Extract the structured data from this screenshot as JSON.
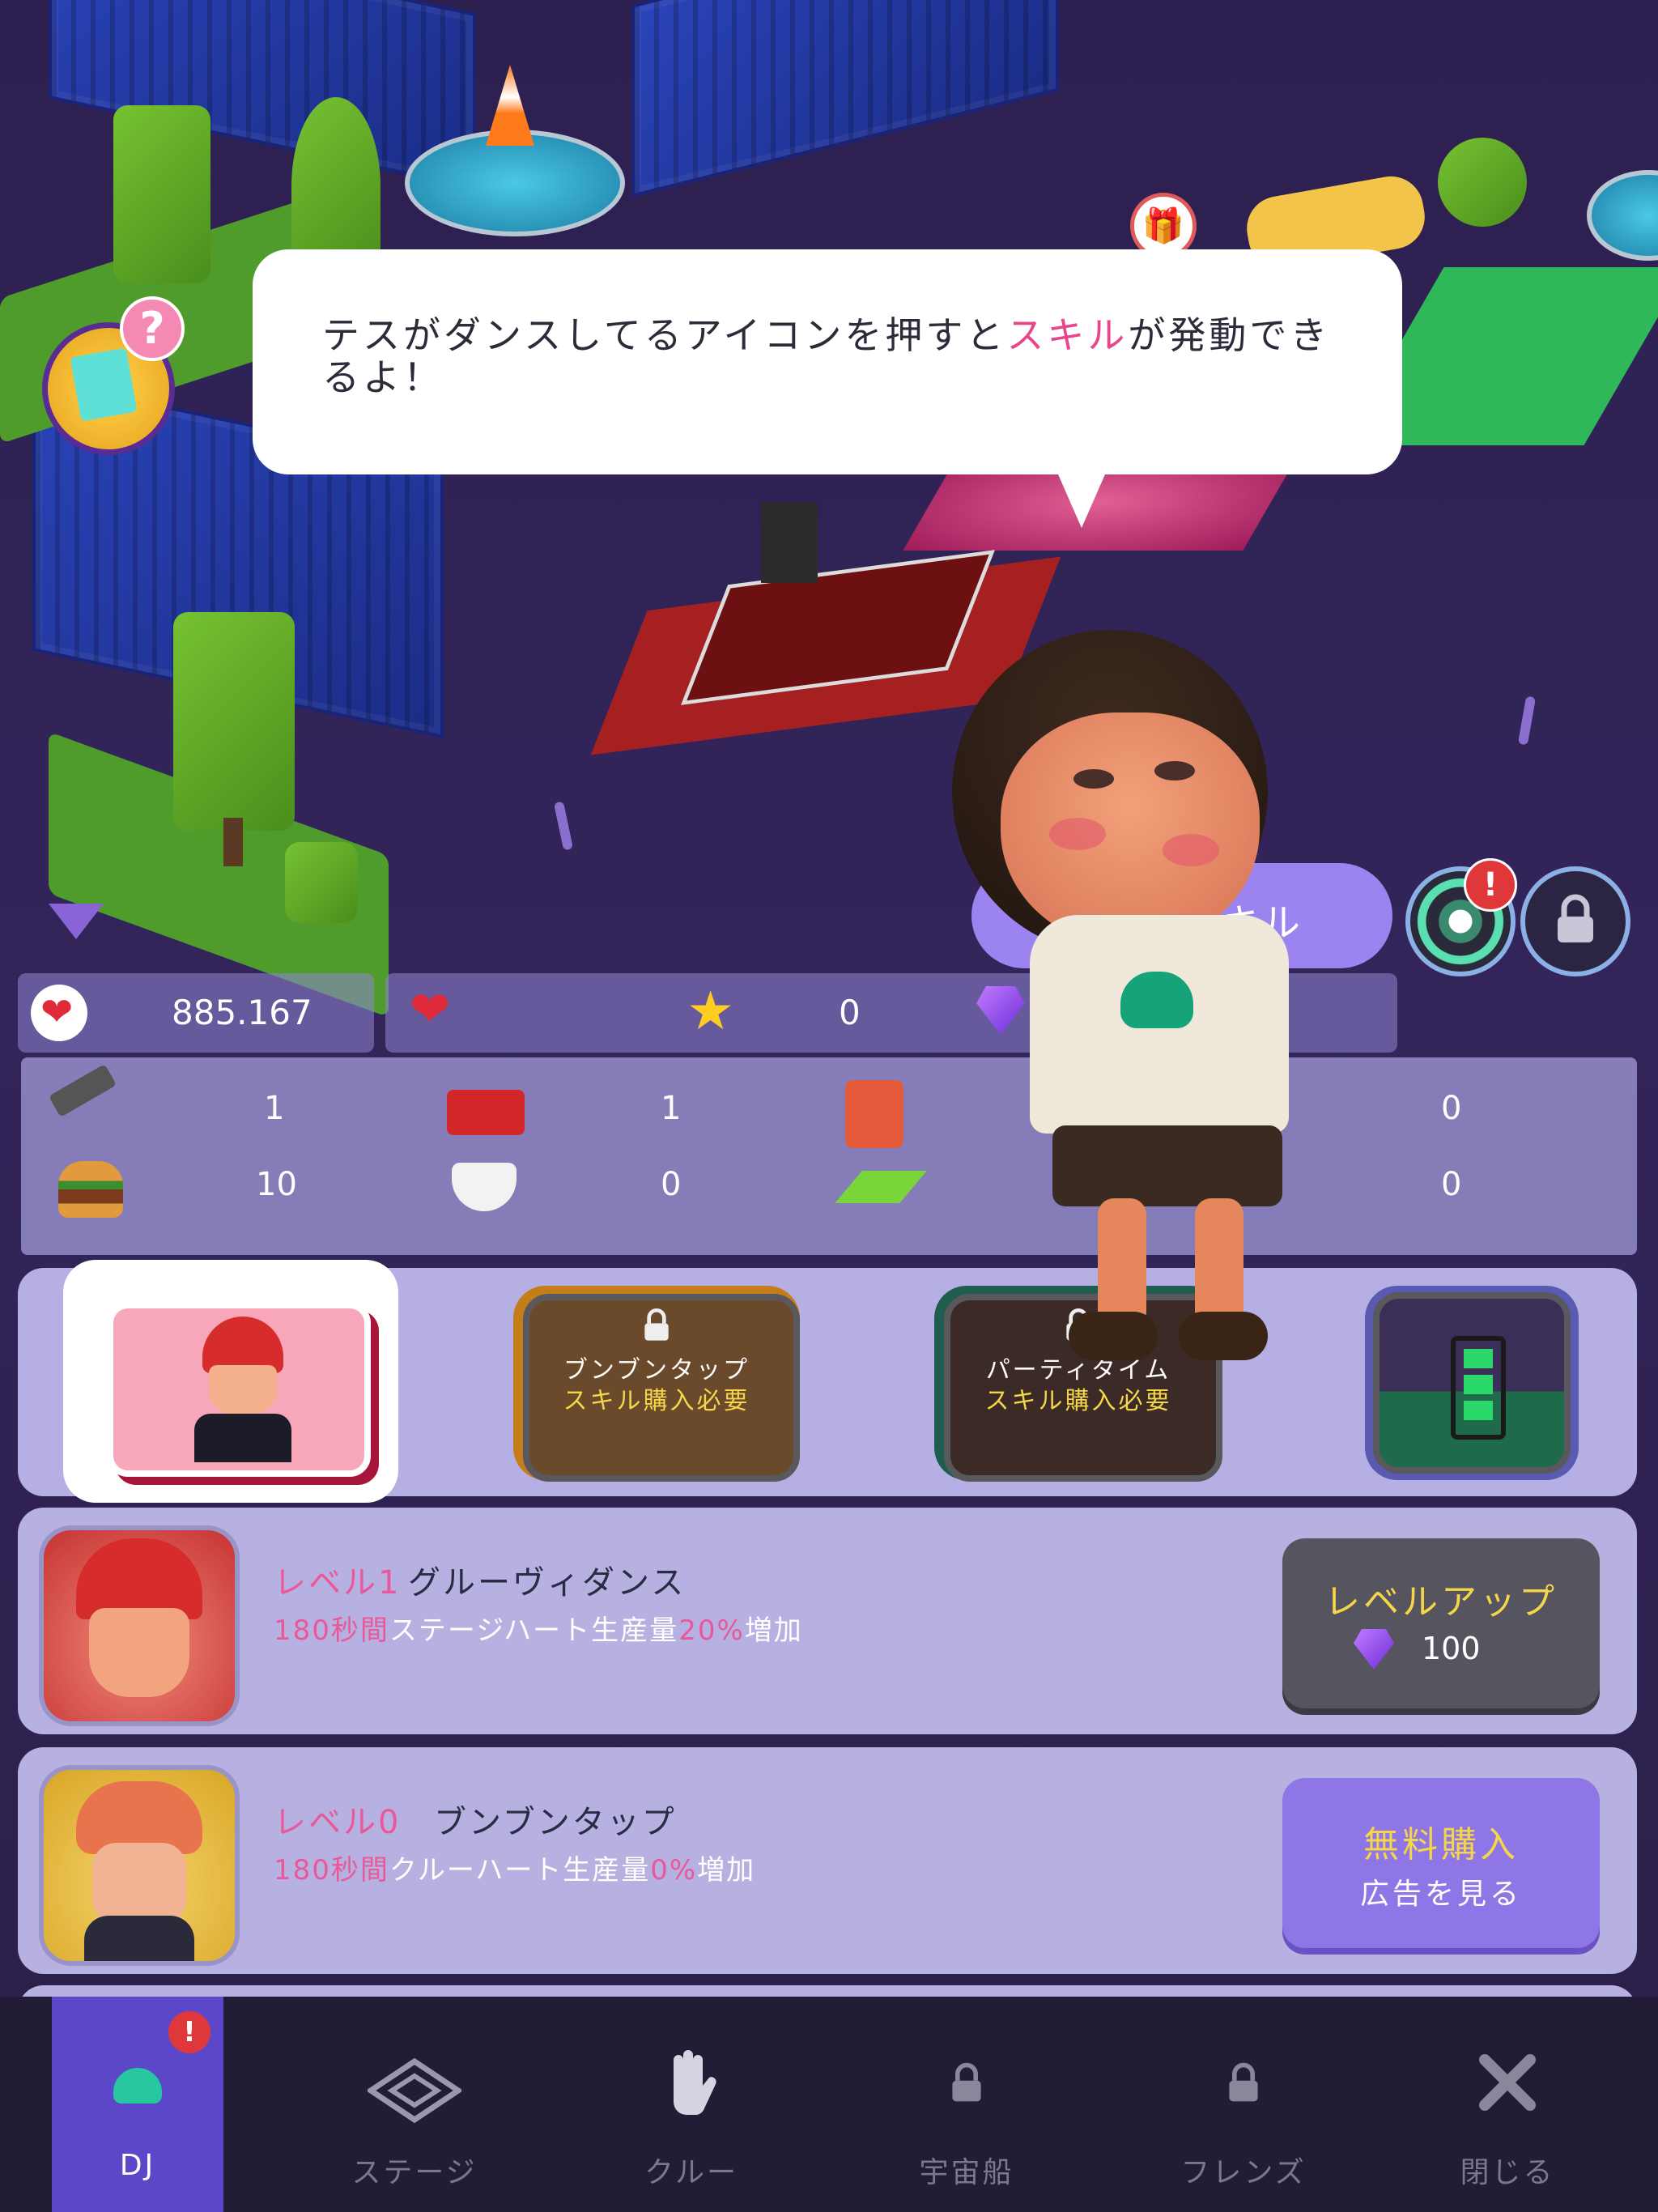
{
  "tutorial": {
    "before": "テスがダンスしてるアイコンを押すと",
    "highlight": "スキル",
    "after": "が発動できるよ！"
  },
  "skill_button_label": "キル",
  "resources": {
    "hearts": "885.167",
    "stars": "0"
  },
  "inventory": {
    "row1": [
      "1",
      "1",
      "0"
    ],
    "row2": [
      "10",
      "0",
      "0"
    ]
  },
  "skill_slots": [
    {
      "title": "",
      "requirement": ""
    },
    {
      "title": "ブンブンタップ",
      "requirement": "スキル購入必要"
    },
    {
      "title": "パーティタイム",
      "requirement": "スキル購入必要"
    },
    {
      "title": "",
      "requirement": ""
    }
  ],
  "skill_cards": [
    {
      "level": "レベル1",
      "name": "グルーヴィダンス",
      "desc_a": "180秒間",
      "desc_b": "ステージハート生産量",
      "desc_c": "20%",
      "desc_d": "増加",
      "button_label": "レベルアップ",
      "button_cost": "100"
    },
    {
      "level": "レベル0",
      "name": "ブンブンタップ",
      "desc_a": "180秒間",
      "desc_b": "クルーハート生産量",
      "desc_c": "0%",
      "desc_d": "増加",
      "button_label": "無料購入",
      "button_sub": "広告を見る"
    }
  ],
  "nav": [
    "DJ",
    "ステージ",
    "クルー",
    "宇宙船",
    "フレンズ",
    "閉じる"
  ],
  "alert_mark": "!",
  "help_mark": "?",
  "colors": {
    "highlight_pink": "#e8458b",
    "levelup_text": "#f3d64a",
    "purchase_button": "#8f76e6",
    "nav_active": "#5d47c9"
  },
  "icons": [
    "heart-icon",
    "heart-timer-icon",
    "star-icon",
    "gem-icon",
    "hammer-icon",
    "ticket-icon",
    "fuel-can-icon",
    "burger-icon",
    "coffee-icon",
    "tile-icon",
    "lock-icon",
    "battery-icon",
    "gift-icon",
    "quest-icon",
    "close-icon"
  ]
}
